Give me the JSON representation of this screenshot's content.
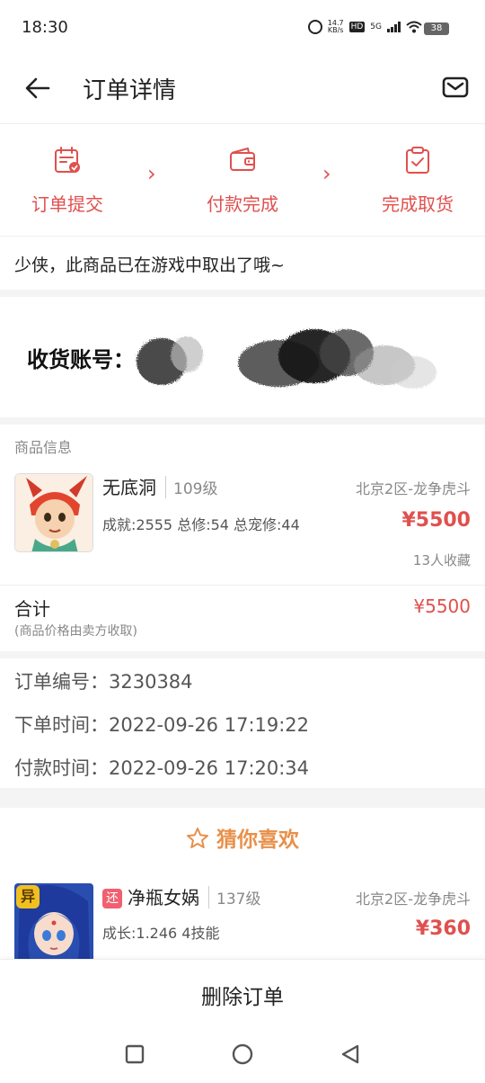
{
  "status_bar": {
    "time": "18:30",
    "net_speed_value": "14.7",
    "net_speed_unit": "KB/s",
    "hd_label": "HD",
    "signal_label": "5G",
    "battery": "38"
  },
  "header": {
    "title": "订单详情",
    "back_icon": "back-arrow-icon",
    "mail_icon": "mail-icon"
  },
  "steps": [
    {
      "label": "订单提交",
      "icon": "calendar-check-icon"
    },
    {
      "label": "付款完成",
      "icon": "wallet-icon"
    },
    {
      "label": "完成取货",
      "icon": "clipboard-check-icon"
    }
  ],
  "notice": "少侠，此商品已在游戏中取出了哦~",
  "account": {
    "label": "收货账号："
  },
  "goods": {
    "section_title": "商品信息",
    "name": "无底洞",
    "level": "109级",
    "server": "北京2区-龙争虎斗",
    "stats": "成就:2555 总修:54 总宠修:44",
    "price": "¥5500",
    "favorites": "13人收藏"
  },
  "total": {
    "label": "合计",
    "note": "(商品价格由卖方收取)",
    "price": "¥5500"
  },
  "order_info": {
    "order_no": "订单编号：3230384",
    "order_time": "下单时间：2022-09-26 17:19:22",
    "pay_time": "付款时间：2022-09-26 17:20:34"
  },
  "recommend": {
    "title": "猜你喜欢",
    "item": {
      "tag": "还",
      "badge": "异",
      "name": "净瓶女娲",
      "level": "137级",
      "server": "北京2区-龙争虎斗",
      "stats": "成长:1.246 4技能",
      "price": "¥360"
    }
  },
  "actions": {
    "delete_order": "删除订单"
  },
  "colors": {
    "accent": "#e0504e",
    "guess_title": "#e8904a"
  }
}
